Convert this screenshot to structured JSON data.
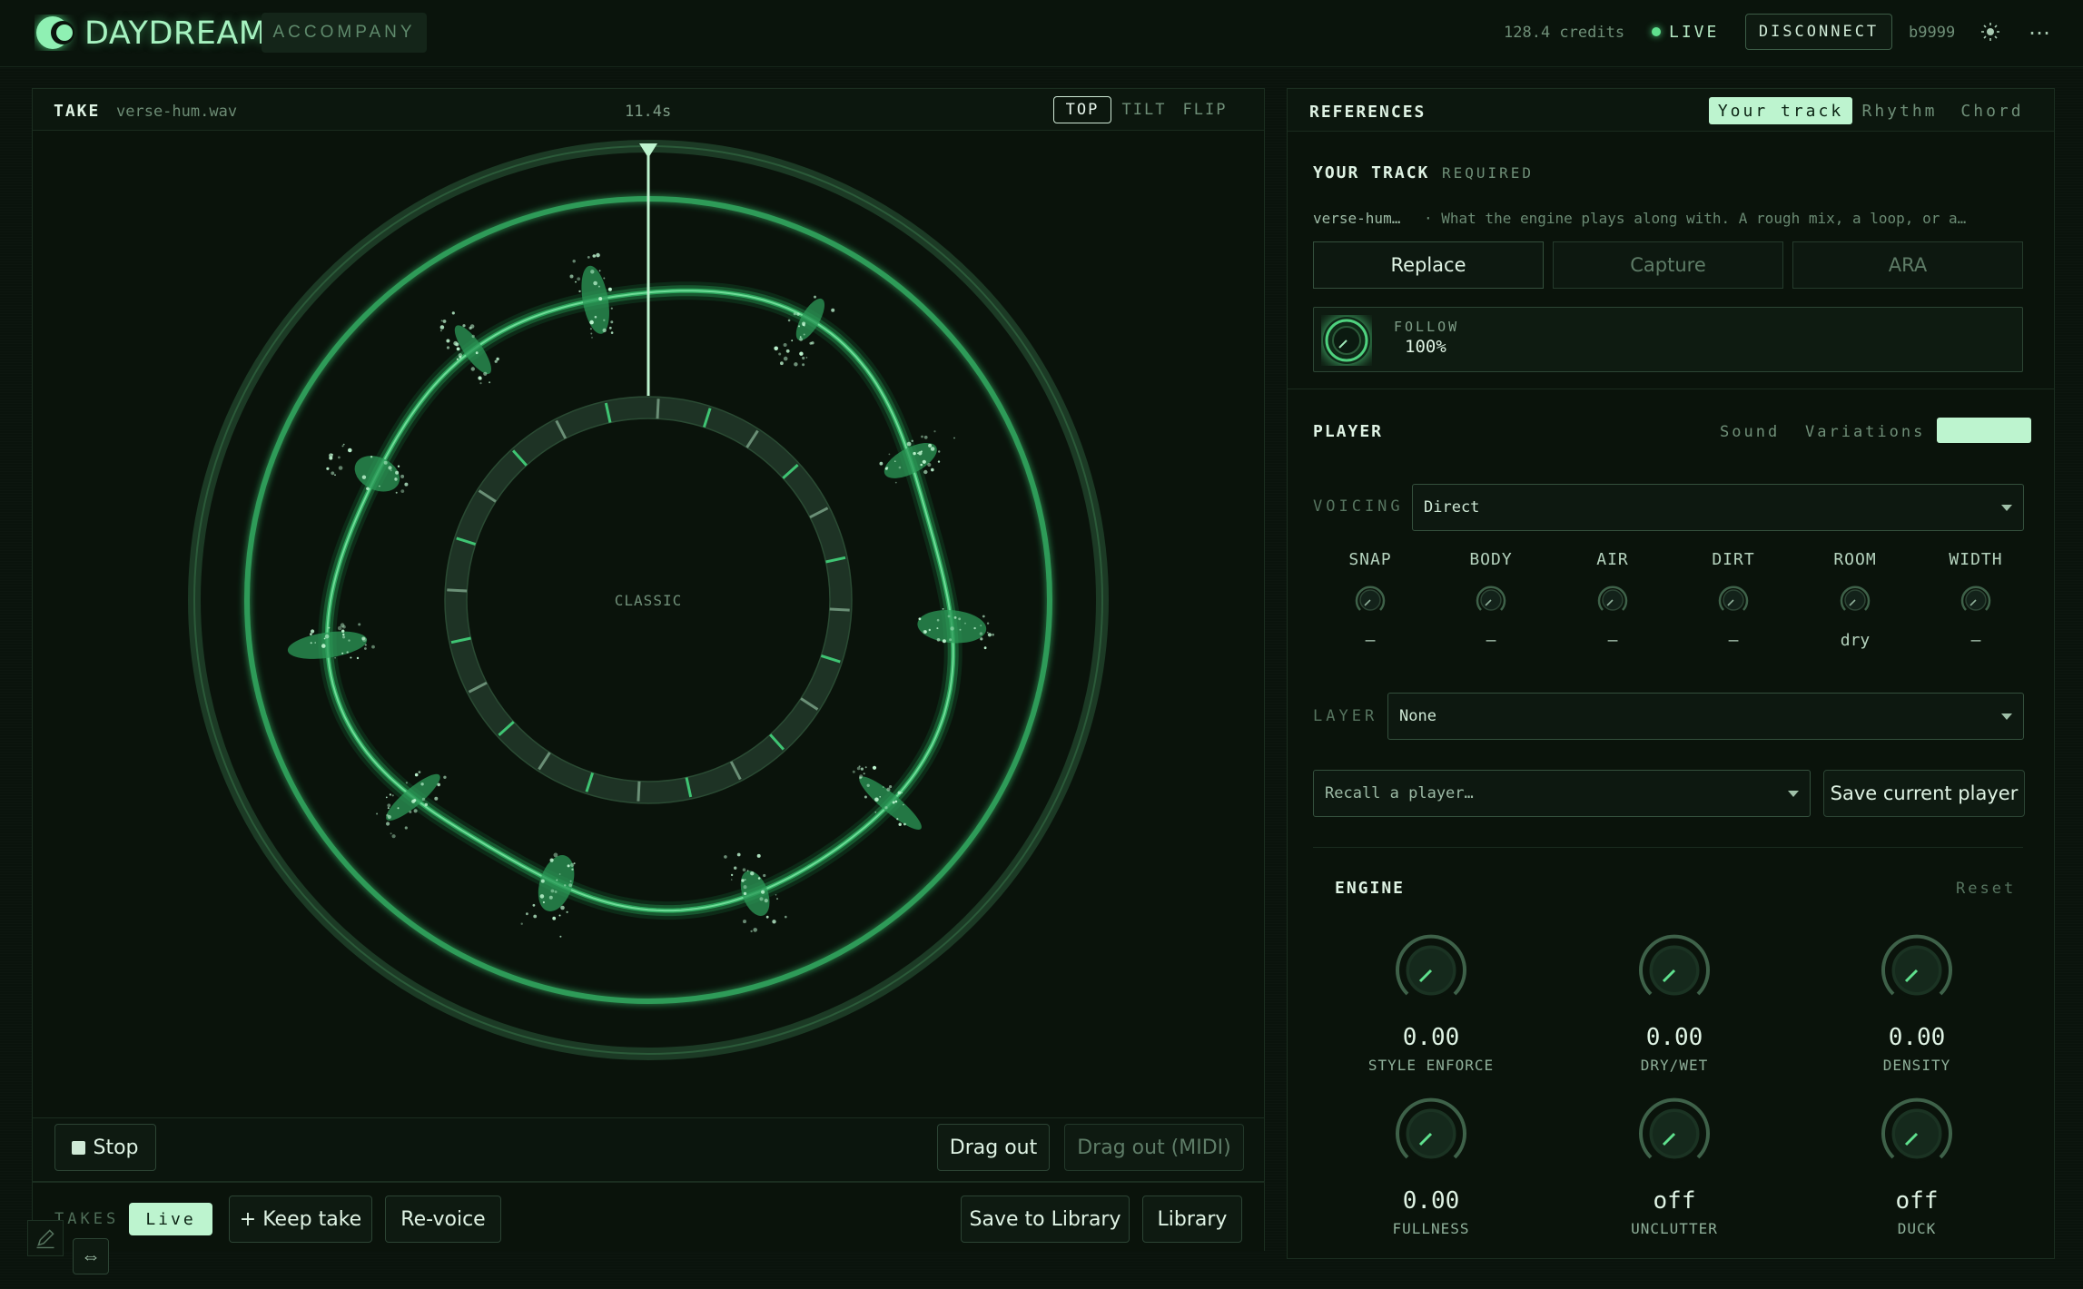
{
  "header": {
    "brand": "DAYDREAM",
    "mode_tab": "ACCOMPANY",
    "credits": "128.4 credits",
    "status": "LIVE",
    "disconnect_label": "DISCONNECT",
    "user_id": "b9999",
    "theme_icon": "sun-icon",
    "more_icon": "more-icon"
  },
  "take": {
    "label": "TAKE",
    "file": "verse-hum.wav",
    "duration": "11.4s",
    "view_tabs": [
      "TOP",
      "TILT",
      "FLIP"
    ],
    "active_view": "TOP",
    "center_label": "CLASSIC"
  },
  "transport": {
    "stop_label": "Stop",
    "drag_out_label": "Drag out",
    "drag_out_midi_label": "Drag out (MIDI)"
  },
  "takes": {
    "label": "TAKES",
    "live_label": "Live",
    "keep_label": "+ Keep take",
    "revoice_label": "Re-voice",
    "save_library_label": "Save to Library",
    "library_label": "Library"
  },
  "references": {
    "title": "REFERENCES",
    "tabs": [
      "Your track",
      "Rhythm",
      "Chord"
    ],
    "active_tab": "Your track",
    "your_track": {
      "title": "YOUR TRACK",
      "required": "REQUIRED",
      "file": "verse-hum…",
      "description": "· What the engine plays along with. A rough mix, a loop, or a…",
      "sources": [
        "Replace",
        "Capture",
        "ARA"
      ],
      "follow_label": "FOLLOW",
      "follow_value": "100%"
    }
  },
  "player": {
    "title": "PLAYER",
    "tabs": [
      "Sound",
      "Variations"
    ],
    "voicing_label": "VOICING",
    "voicing_value": "Direct",
    "small_knobs": [
      {
        "name": "SNAP",
        "value": "–"
      },
      {
        "name": "BODY",
        "value": "–"
      },
      {
        "name": "AIR",
        "value": "–"
      },
      {
        "name": "DIRT",
        "value": "–"
      },
      {
        "name": "ROOM",
        "value": "dry"
      },
      {
        "name": "WIDTH",
        "value": "–"
      }
    ],
    "layer_label": "LAYER",
    "layer_value": "None",
    "recall_placeholder": "Recall a player…",
    "save_label": "Save current player"
  },
  "engine": {
    "title": "ENGINE",
    "reset_label": "Reset",
    "knobs": [
      {
        "name": "STYLE ENFORCE",
        "value": "0.00"
      },
      {
        "name": "DRY/WET",
        "value": "0.00"
      },
      {
        "name": "DENSITY",
        "value": "0.00"
      },
      {
        "name": "FULLNESS",
        "value": "0.00"
      },
      {
        "name": "UNCLUTTER",
        "value": "off"
      },
      {
        "name": "DUCK",
        "value": "off"
      }
    ]
  },
  "colors": {
    "accent": "#4fd27f",
    "accent_light": "#bdf4cf",
    "background": "#0a130c",
    "panel_border": "#1b2e20"
  }
}
